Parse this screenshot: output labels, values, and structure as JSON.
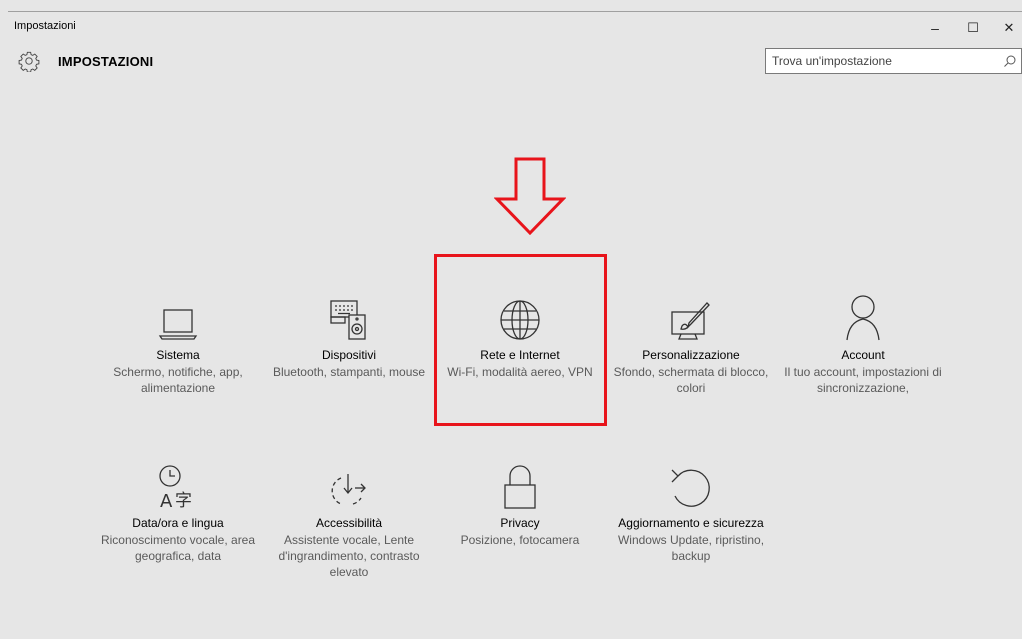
{
  "window": {
    "title": "Impostazioni",
    "controls": {
      "minimize": "–",
      "maximize": "☐",
      "close": "✕"
    }
  },
  "header": {
    "title": "IMPOSTAZIONI",
    "search_placeholder": "Trova un'impostazione"
  },
  "tiles": [
    {
      "label": "Sistema",
      "desc": "Schermo, notifiche, app, alimentazione",
      "icon": "laptop-icon"
    },
    {
      "label": "Dispositivi",
      "desc": "Bluetooth, stampanti, mouse",
      "icon": "devices-icon"
    },
    {
      "label": "Rete e Internet",
      "desc": "Wi-Fi, modalità aereo, VPN",
      "icon": "globe-icon"
    },
    {
      "label": "Personalizzazione",
      "desc": "Sfondo, schermata di blocco, colori",
      "icon": "paint-monitor-icon"
    },
    {
      "label": "Account",
      "desc": "Il tuo account, impostazioni di sincronizzazione,",
      "icon": "person-icon"
    },
    {
      "label": "Data/ora e lingua",
      "desc": "Riconoscimento vocale, area geografica, data",
      "icon": "time-language-icon"
    },
    {
      "label": "Accessibilità",
      "desc": "Assistente vocale, Lente d'ingrandimento, contrasto elevato",
      "icon": "accessibility-icon"
    },
    {
      "label": "Privacy",
      "desc": "Posizione, fotocamera",
      "icon": "lock-icon"
    },
    {
      "label": "Aggiornamento e sicurezza",
      "desc": "Windows Update, ripristino, backup",
      "icon": "refresh-icon"
    }
  ],
  "colors": {
    "highlight": "#e8141b",
    "background": "#e6e6e6",
    "icon": "#333333"
  }
}
